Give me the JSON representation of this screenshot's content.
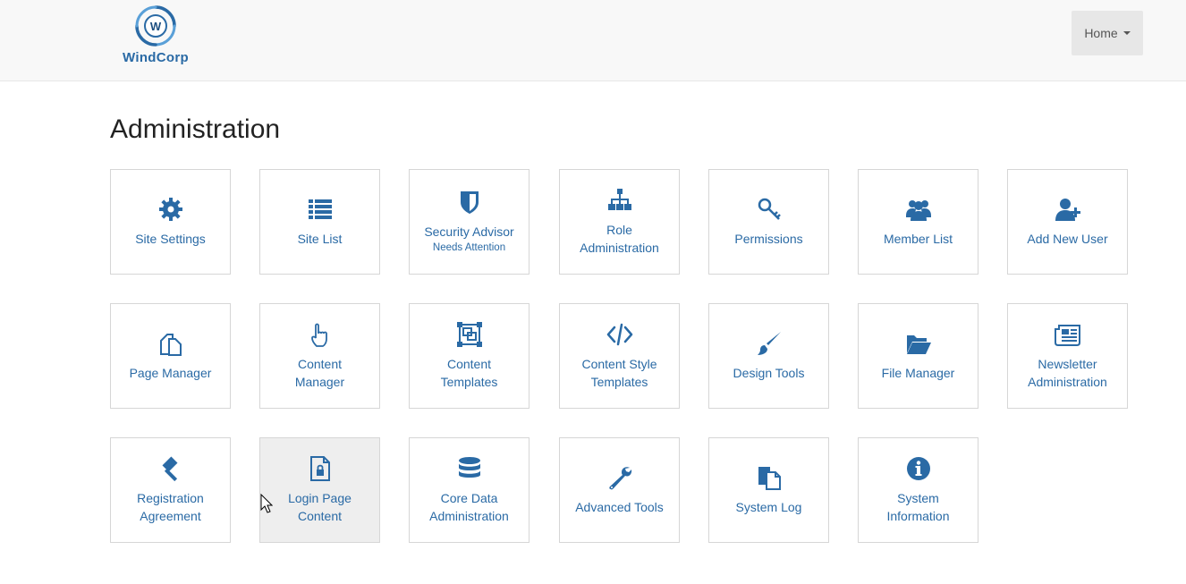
{
  "brand": {
    "name": "WindCorp",
    "mark_letter": "W"
  },
  "nav": {
    "home_label": "Home"
  },
  "page": {
    "title": "Administration"
  },
  "colors": {
    "accent": "#2a6aa5",
    "navbar_bg": "#f8f8f8",
    "tile_border": "#d6d6d6",
    "hover_bg": "#eeeeee"
  },
  "tiles": [
    {
      "icon": "gear-icon",
      "lines": [
        "Site Settings"
      ]
    },
    {
      "icon": "list-icon",
      "lines": [
        "Site List"
      ]
    },
    {
      "icon": "shield-icon",
      "lines": [
        "Security Advisor"
      ],
      "sub": "Needs Attention"
    },
    {
      "icon": "sitemap-icon",
      "lines": [
        "Role",
        "Administration"
      ]
    },
    {
      "icon": "key-icon",
      "lines": [
        "Permissions"
      ]
    },
    {
      "icon": "users-icon",
      "lines": [
        "Member List"
      ]
    },
    {
      "icon": "user-plus-icon",
      "lines": [
        "Add New User"
      ]
    },
    {
      "icon": "pages-icon",
      "lines": [
        "Page Manager"
      ]
    },
    {
      "icon": "hand-pointer-icon",
      "lines": [
        "Content",
        "Manager"
      ]
    },
    {
      "icon": "template-icon",
      "lines": [
        "Content",
        "Templates"
      ]
    },
    {
      "icon": "code-icon",
      "lines": [
        "Content Style",
        "Templates"
      ]
    },
    {
      "icon": "paintbrush-icon",
      "lines": [
        "Design Tools"
      ]
    },
    {
      "icon": "folder-open-icon",
      "lines": [
        "File Manager"
      ]
    },
    {
      "icon": "newspaper-icon",
      "lines": [
        "Newsletter",
        "Administration"
      ]
    },
    {
      "icon": "gavel-icon",
      "lines": [
        "Registration",
        "Agreement"
      ]
    },
    {
      "icon": "locked-file-icon",
      "lines": [
        "Login Page",
        "Content"
      ],
      "hover": true
    },
    {
      "icon": "database-icon",
      "lines": [
        "Core Data",
        "Administration"
      ]
    },
    {
      "icon": "wrench-icon",
      "lines": [
        "Advanced Tools"
      ]
    },
    {
      "icon": "log-file-icon",
      "lines": [
        "System Log"
      ]
    },
    {
      "icon": "info-circle-icon",
      "lines": [
        "System",
        "Information"
      ]
    }
  ]
}
